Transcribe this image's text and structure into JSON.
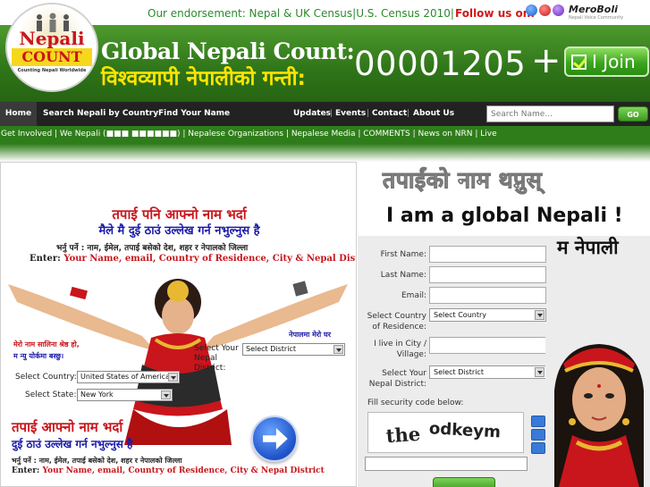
{
  "topbar": {
    "endorsement": "Our endorsement: Nepal & UK Census|U.S. Census 2010|",
    "follow_label": "Follow us on:",
    "partner_logo": "MeroBoli"
  },
  "logo": {
    "top": "Nepali",
    "bottom": "COUNT",
    "tagline": "Counting Nepali Worldwide"
  },
  "banner": {
    "title_en": "Global Nepali Count:",
    "title_np": "विश्वव्यापी नेपालीको गन्ती:",
    "counter": "00001205",
    "plus": "+",
    "join_label": "I Join"
  },
  "nav": {
    "items": [
      "Home",
      "Search Nepali by Country",
      "Find Your Name"
    ],
    "right_items": [
      "Updates",
      "Events",
      "Contact",
      "About Us"
    ],
    "search_placeholder": "Search Name...",
    "go_label": "GO"
  },
  "subnav": {
    "text": "Get Involved | We Nepali (■■■ ■■■■■■) | Nepalese Organizations | Nepalese Media | COMMENTS | News on NRN | Live"
  },
  "promo": {
    "line1_np": "तपाई पनि आफ्नो नाम भर्दा",
    "line2_np": "मैले मै दुई ठाउं उल्लेख गर्न नभुल्नुस है",
    "line3_np": "भर्नु पर्ने : नाम, ईमेल, तपाई बसेको देश, शहर र नेपालको जिल्ला",
    "enter_label": "Enter:",
    "enter_fields": "Your Name, email, Country of Residence, City & Nepal District",
    "caption1": "मेरो नाम सालिना श्रेष्ठ हो,",
    "caption2": "म न्यु योर्कमा बस्छु।",
    "home_caption": "नेपालमा मेरो घर",
    "select_country_label": "Select Country:",
    "country_value": "United States of America",
    "select_state_label": "Select State:",
    "state_value": "New York",
    "district_label": "Select Your Nepal District:",
    "district_value": "Select District",
    "bottom_line1_np": "तपाई आफ्नो नाम भर्दा",
    "bottom_line2_np": "दुई ठाउं उल्लेख गर्न नभुल्नुस है",
    "bottom_line3_np": "भर्नु पर्ने : नाम, ईमेल, तपाई बसेको देश, शहर र नेपालको जिल्ला",
    "bottom_enter_label": "Enter:",
    "bottom_enter_fields": "Your Name, email, Country of Residence, City & Nepal District"
  },
  "form": {
    "heading_np": "तपाईंको नाम थप्नुस्",
    "slogan": "I am a global Nepali !",
    "slogan_np": "म नेपाली",
    "first_name_label": "First Name:",
    "last_name_label": "Last Name:",
    "email_label": "Email:",
    "country_label": "Select Country of Residence:",
    "country_value": "Select Country",
    "city_label": "I live in City / Village:",
    "district_label": "Select Your Nepal District:",
    "district_value": "Select District",
    "security_label": "Fill security code below:",
    "captcha_words": [
      "the",
      "odkeym"
    ]
  },
  "colors": {
    "brand_green": "#2e7418",
    "nav_dark": "#222222",
    "accent_red": "#c8161c",
    "accent_blue": "#1a1aa8",
    "banner_yellow": "#ffe400"
  }
}
